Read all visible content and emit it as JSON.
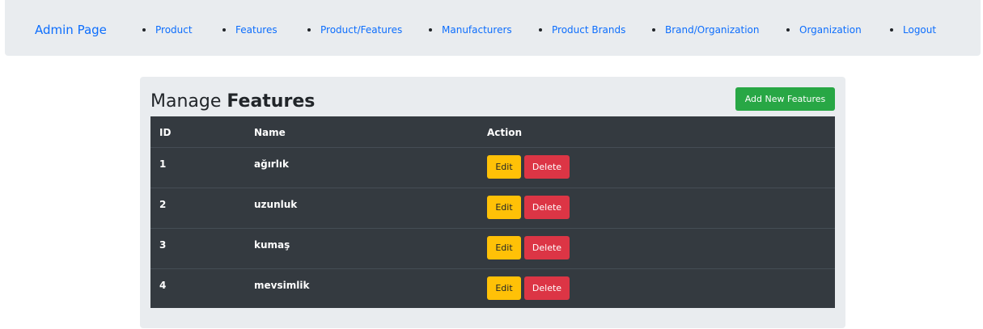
{
  "nav": {
    "brand": "Admin Page",
    "items": [
      "Product",
      "Features",
      "Product/Features",
      "Manufacturers",
      "Product Brands",
      "Brand/Organization",
      "Organization",
      "Logout"
    ]
  },
  "page": {
    "title_prefix": "Manage",
    "title_bold": "Features",
    "add_button": "Add New Features"
  },
  "table": {
    "headers": [
      "ID",
      "Name",
      "Action"
    ],
    "rows": [
      {
        "id": "1",
        "name": "ağırlık"
      },
      {
        "id": "2",
        "name": "uzunluk"
      },
      {
        "id": "3",
        "name": "kumaş"
      },
      {
        "id": "4",
        "name": "mevsimlik"
      }
    ],
    "edit_label": "Edit",
    "delete_label": "Delete"
  },
  "colors": {
    "link": "#0d6efd",
    "add": "#28a745",
    "edit": "#ffc107",
    "delete": "#dc3545",
    "table_bg": "#343a40"
  }
}
